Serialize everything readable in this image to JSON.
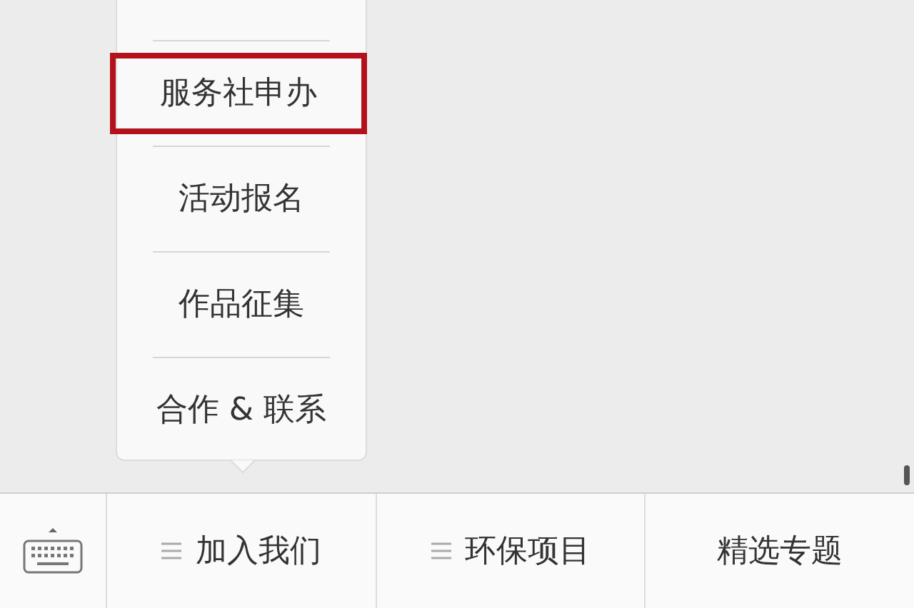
{
  "popup_menu": {
    "items": [
      {
        "label": "服务社申办",
        "selected": true
      },
      {
        "label": "活动报名",
        "selected": false
      },
      {
        "label": "作品征集",
        "selected": false
      },
      {
        "label": "合作 & 联系",
        "selected": false
      }
    ]
  },
  "menu_bar": {
    "items": [
      {
        "label": "加入我们",
        "submenu": true
      },
      {
        "label": "环保项目",
        "submenu": true
      },
      {
        "label": "精选专题",
        "submenu": false
      }
    ]
  }
}
